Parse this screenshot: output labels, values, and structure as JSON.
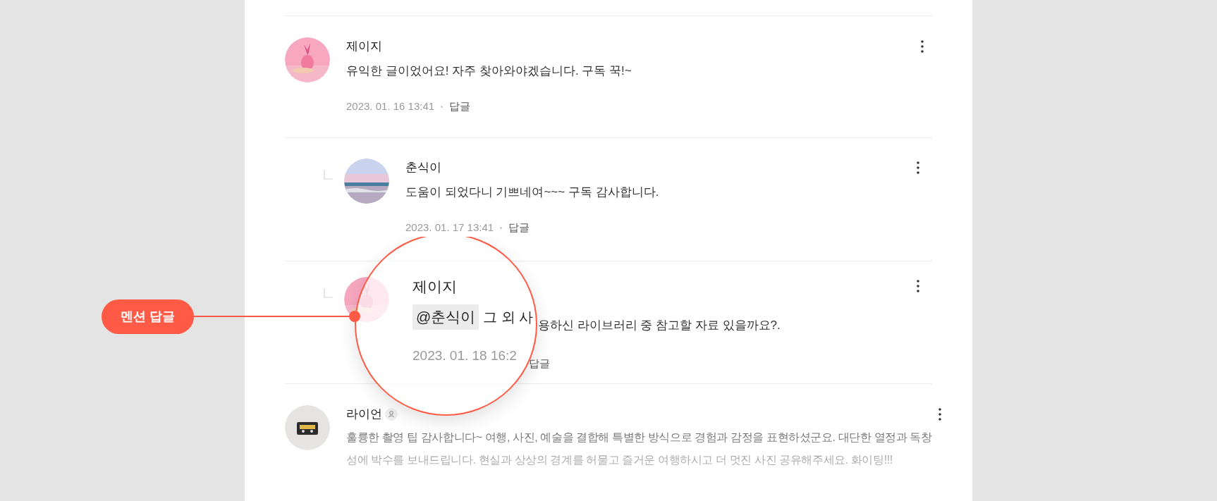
{
  "comments": [
    {
      "kind": "comment",
      "author": "제이지",
      "body": "유익한 글이었어요! 자주 찾아와야겠습니다. 구독 꾹!~",
      "date": "2023. 01. 16 13:41",
      "reply_link": "답글"
    },
    {
      "kind": "reply",
      "author": "춘식이",
      "body": "도움이 되었다니 기쁘네여~~~ 구독 감사합니다.",
      "date": "2023. 01. 17 13:41",
      "reply_link": "답글"
    },
    {
      "kind": "magnified",
      "author": "제이지",
      "mention": "@춘식이",
      "body_start": "그 외 사",
      "body_rest": "용하신 라이브러리 중 참고할 자료 있을까요?.",
      "date": "2023. 01. 18 16:2",
      "reply_link": "답글"
    },
    {
      "kind": "comment",
      "author": "라이언",
      "author_badge": true,
      "body": "훌륭한 촬영 팁 감사합니다~ 여행, 사진, 예술을 결합해 특별한 방식으로 경험과 감정을 표현하셨군요. 대단한 열정과 독창성에 박수를 보내드립니다. 현실과 상상의 경계를 허물고 즐거운 여행하시고 더 멋진 사진 공유해주세요. 화이팅!!!"
    }
  ],
  "callout": {
    "label": "멘션 답글"
  }
}
